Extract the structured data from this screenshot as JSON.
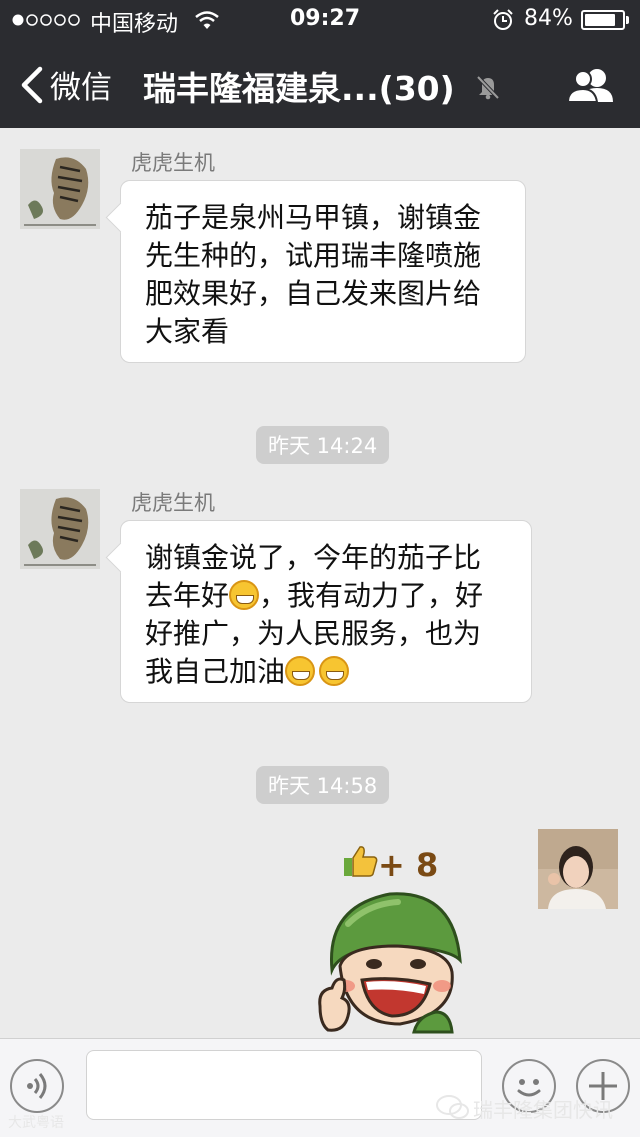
{
  "status_bar": {
    "carrier": "中国移动",
    "time": "09:27",
    "battery": "84%",
    "battery_level": 0.84
  },
  "nav": {
    "back_label": "微信",
    "title": "瑞丰隆福建泉...(30)"
  },
  "messages": [
    {
      "sender": "虎虎生机",
      "text_lines": [
        "茄子是泉州马甲镇，谢镇金",
        "先生种的，试用瑞丰隆喷施",
        "肥效果好，自己发来图片给",
        "大家看"
      ]
    },
    {
      "time": "昨天 14:24"
    },
    {
      "sender": "虎虎生机",
      "line1": "谢镇金说了，今年的茄子比",
      "line2a": "去年好",
      "line2b": "，我有动力了，好",
      "line3": "好推广，为人民服务，也为",
      "line4": "我自己加油"
    },
    {
      "time": "昨天 14:58"
    },
    {
      "sticker_text": "+ 8"
    }
  ],
  "watermarks": {
    "right": "瑞丰隆集团快讯",
    "left": "大武粤语"
  },
  "colors": {
    "nav_bg": "#2b2c30",
    "chat_bg": "#ebebeb",
    "bubble_bg": "#ffffff",
    "timestamp_bg": "#cecece"
  }
}
